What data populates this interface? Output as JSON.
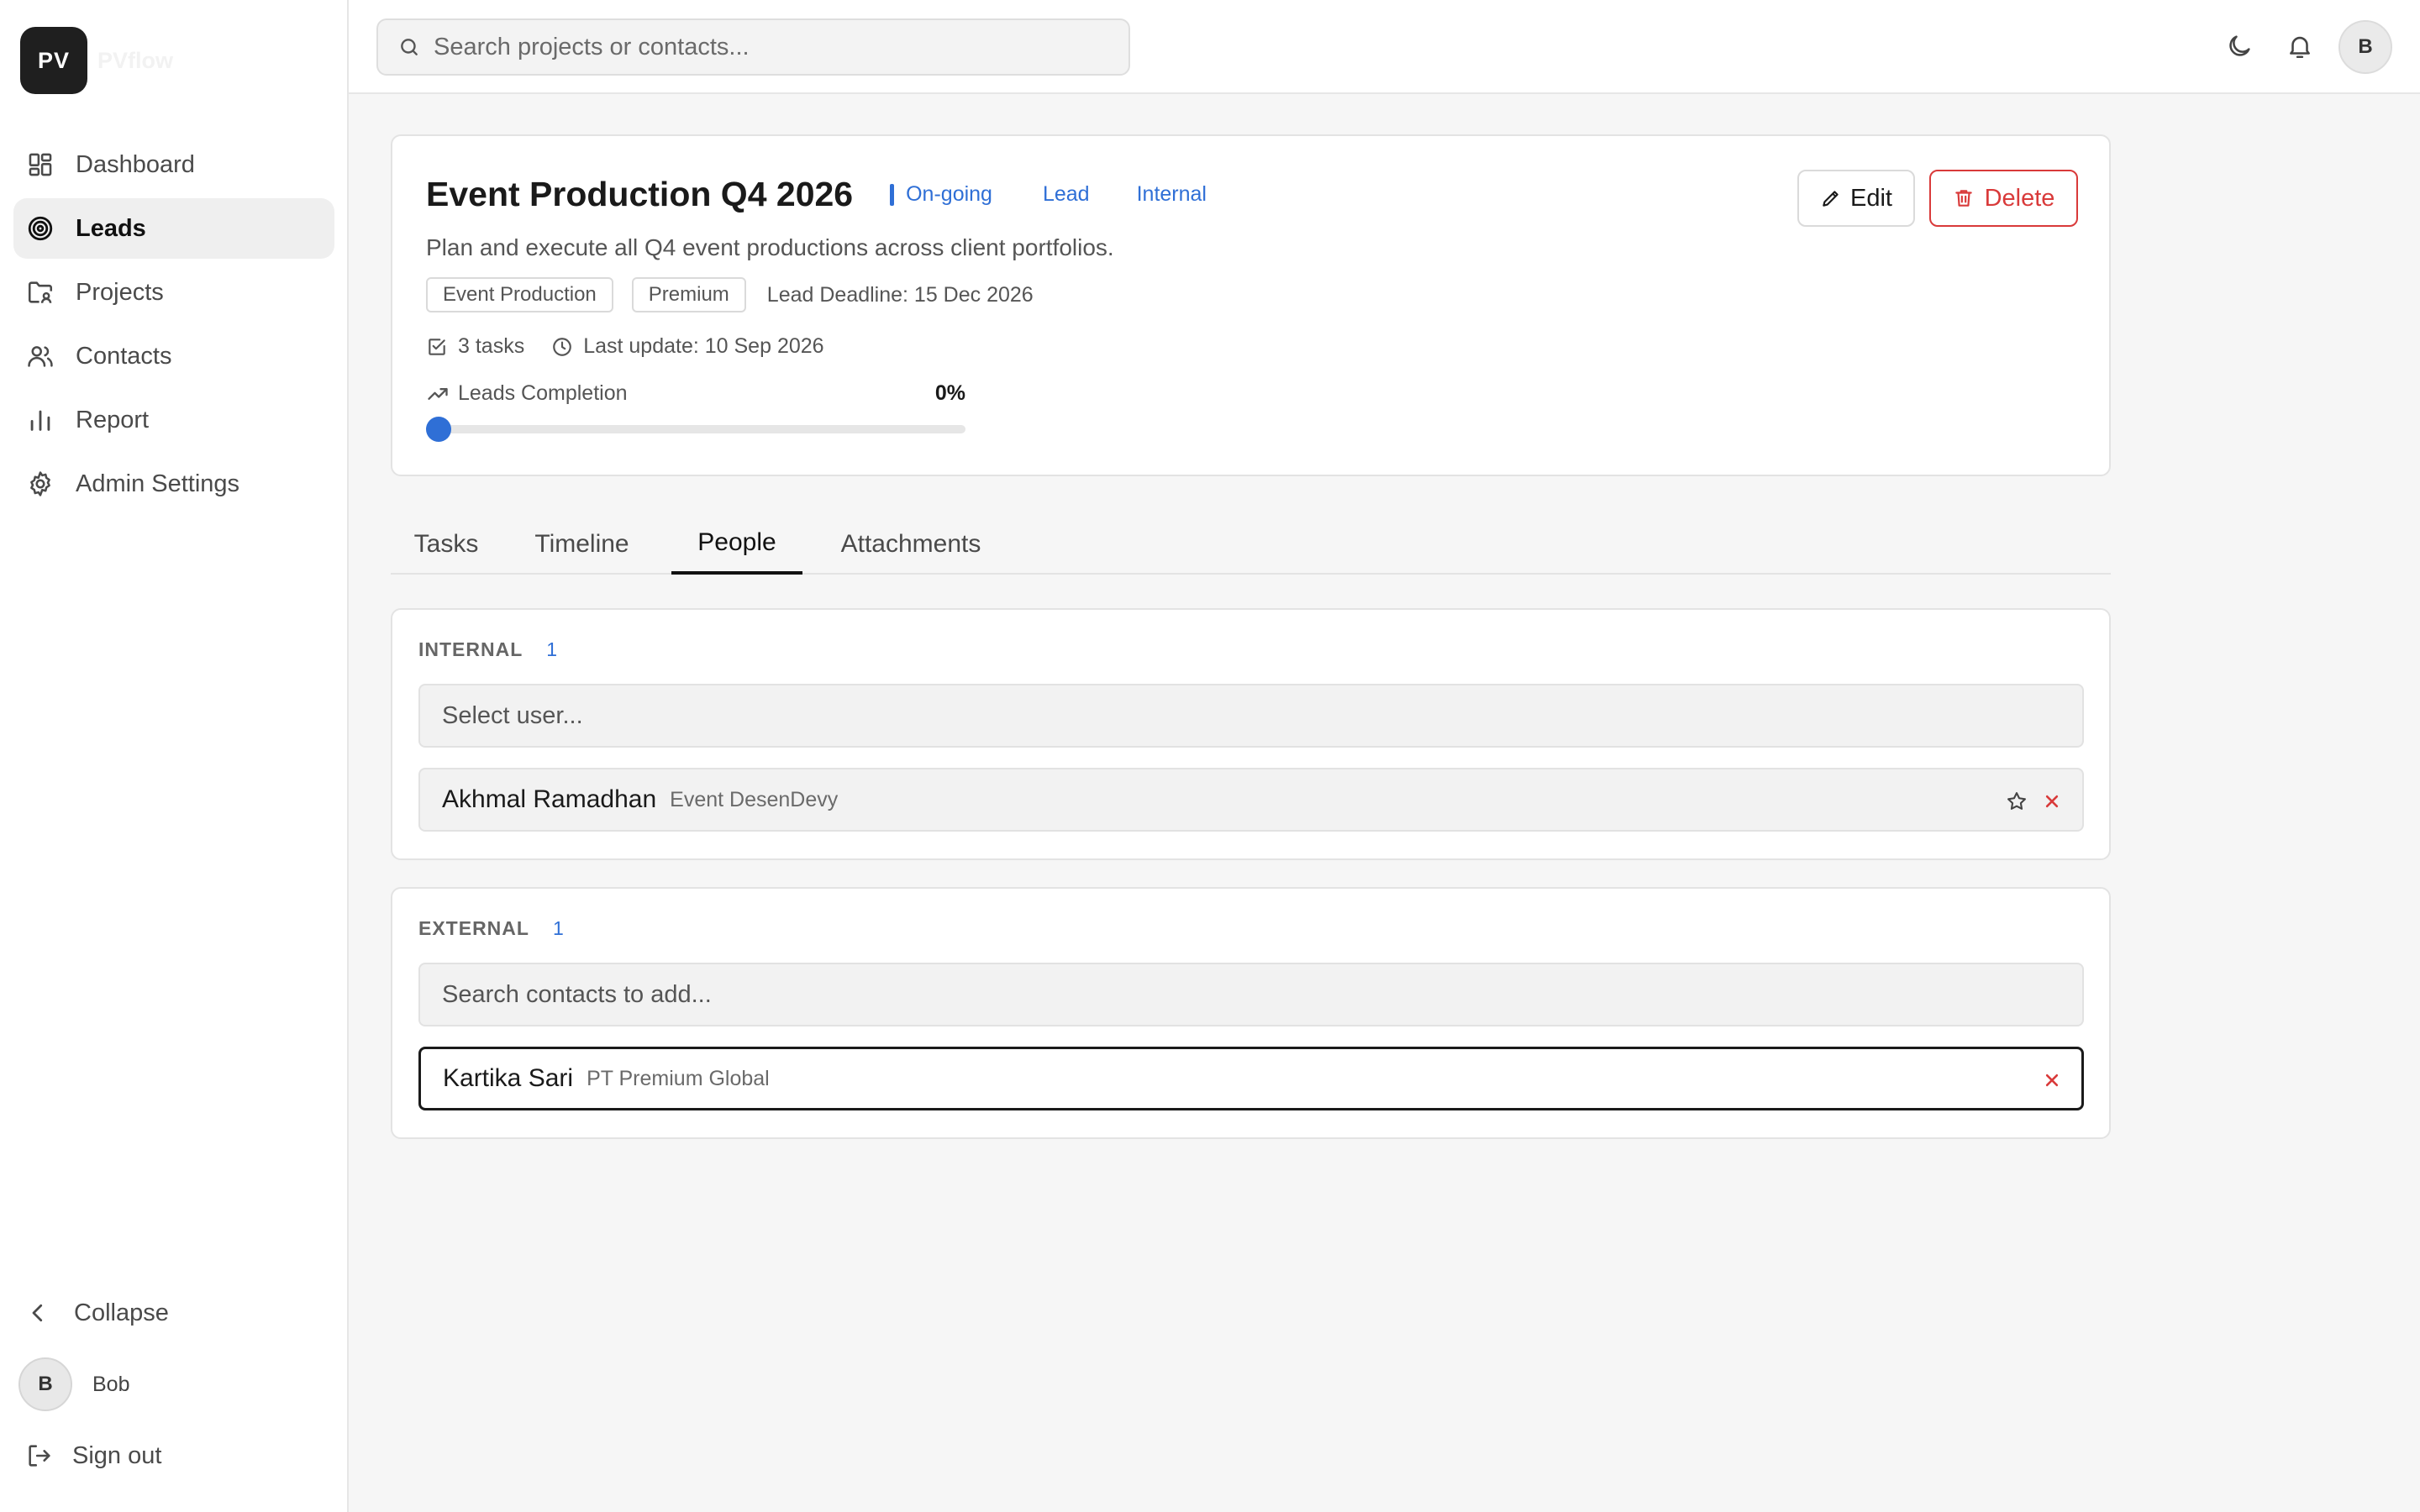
{
  "brand": {
    "logo_initials": "PV",
    "app_name": "PVflow"
  },
  "sidebar": {
    "items": [
      {
        "label": "Dashboard",
        "icon": "dashboard-icon"
      },
      {
        "label": "Leads",
        "icon": "target-icon",
        "active": true
      },
      {
        "label": "Projects",
        "icon": "folder-user-icon"
      },
      {
        "label": "Contacts",
        "icon": "users-icon"
      },
      {
        "label": "Report",
        "icon": "bar-chart-icon"
      },
      {
        "label": "Admin Settings",
        "icon": "gear-icon"
      }
    ],
    "collapse_label": "Collapse",
    "user": {
      "initial": "B",
      "name": "Bob"
    },
    "signout_label": "Sign out"
  },
  "topbar": {
    "search_placeholder": "Search projects or contacts...",
    "avatar_initial": "B"
  },
  "project": {
    "title": "Event Production Q4 2026",
    "status": "On-going",
    "type": "Lead",
    "scope": "Internal",
    "description": "Plan and execute all Q4 event productions across client portfolios.",
    "tags": [
      "Event Production",
      "Premium"
    ],
    "deadline": "Lead Deadline: 15 Dec 2026",
    "tasks_count": "3 tasks",
    "last_update": "Last update: 10 Sep 2026",
    "progress_label": "Leads Completion",
    "progress_text": "0%",
    "progress_value": 0,
    "edit_label": "Edit",
    "delete_label": "Delete"
  },
  "tabs": [
    {
      "label": "Tasks"
    },
    {
      "label": "Timeline"
    },
    {
      "label": "People",
      "active": true
    },
    {
      "label": "Attachments"
    }
  ],
  "people": {
    "internal": {
      "title": "INTERNAL",
      "count": "1",
      "select_placeholder": "Select user...",
      "members": [
        {
          "name": "Akhmal Ramadhan",
          "org": "Event DesenDevy"
        }
      ]
    },
    "external": {
      "title": "EXTERNAL",
      "count": "1",
      "search_placeholder": "Search contacts to add...",
      "members": [
        {
          "name": "Kartika Sari",
          "org": "PT Premium Global"
        }
      ]
    }
  },
  "colors": {
    "accent": "#2f6fd6",
    "danger": "#d93a3a",
    "sidebar_active_bg": "#efefef",
    "page_bg": "#f6f6f6"
  }
}
